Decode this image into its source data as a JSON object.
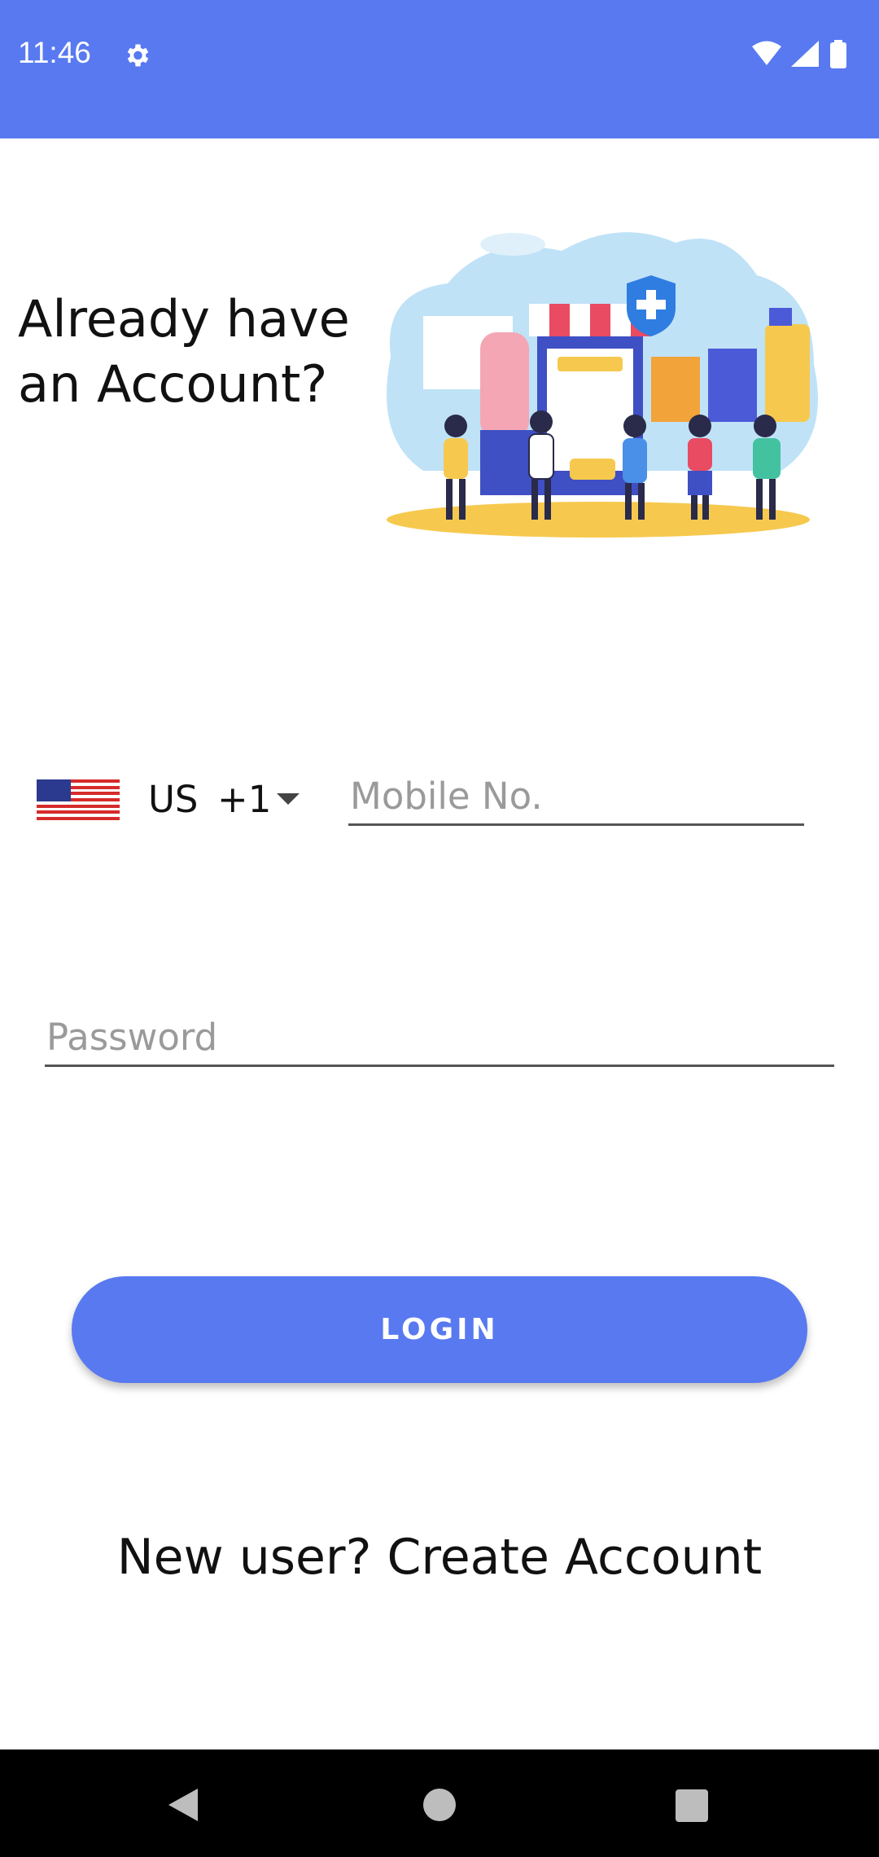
{
  "status_bar": {
    "time": "11:46",
    "settings_icon": "gear-icon",
    "wifi_icon": "wifi-icon",
    "signal_icon": "cell-signal-icon",
    "battery_icon": "battery-icon",
    "color": "#5879F0"
  },
  "login": {
    "headline": "Already have an Account?",
    "illustration": "pharmacy-shopping-illustration",
    "country": {
      "flag_icon": "us-flag-icon",
      "code": "US",
      "dial_code": "+1"
    },
    "mobile_placeholder": "Mobile No.",
    "mobile_value": "",
    "password_placeholder": "Password",
    "password_value": "",
    "login_button": "LOGIN",
    "create_account_link": "New user? Create Account"
  },
  "nav_bar": {
    "back_icon": "back-triangle-icon",
    "home_icon": "home-circle-icon",
    "recents_icon": "recents-square-icon"
  }
}
